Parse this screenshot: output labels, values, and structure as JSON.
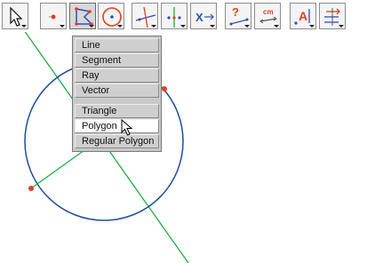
{
  "toolbar": {
    "tools": [
      {
        "name": "pointer-tool-button",
        "icon": "arrow-pointer-icon"
      },
      {
        "name": "point-tool-button",
        "icon": "point-icon"
      },
      {
        "name": "polygon-tool-button",
        "icon": "polygon-icon",
        "active": true
      },
      {
        "name": "circle-tool-button",
        "icon": "circle-icon"
      },
      {
        "name": "perpendicular-tool-button",
        "icon": "perpendicular-line-icon"
      },
      {
        "name": "midpoint-tool-button",
        "icon": "midpoint-icon"
      },
      {
        "name": "transform-tool-button",
        "icon": "x-arrow-icon",
        "label": "X"
      },
      {
        "name": "measure-question-tool-button",
        "icon": "question-measure-icon",
        "label": "?"
      },
      {
        "name": "measure-cm-tool-button",
        "icon": "cm-measure-icon",
        "label": "cm"
      },
      {
        "name": "text-label-tool-button",
        "icon": "text-label-icon",
        "label": "A"
      },
      {
        "name": "display-tool-button",
        "icon": "display-arrows-icon"
      }
    ]
  },
  "menu": {
    "items": [
      "Line",
      "Segment",
      "Ray",
      "Vector"
    ],
    "items2": [
      "Triangle",
      "Polygon",
      "Regular Polygon"
    ],
    "highlighted": "Polygon"
  },
  "colors": {
    "circle": "#1f4e9e",
    "line": "#22aa44",
    "point": "#e04020",
    "accent": "#e04020"
  }
}
